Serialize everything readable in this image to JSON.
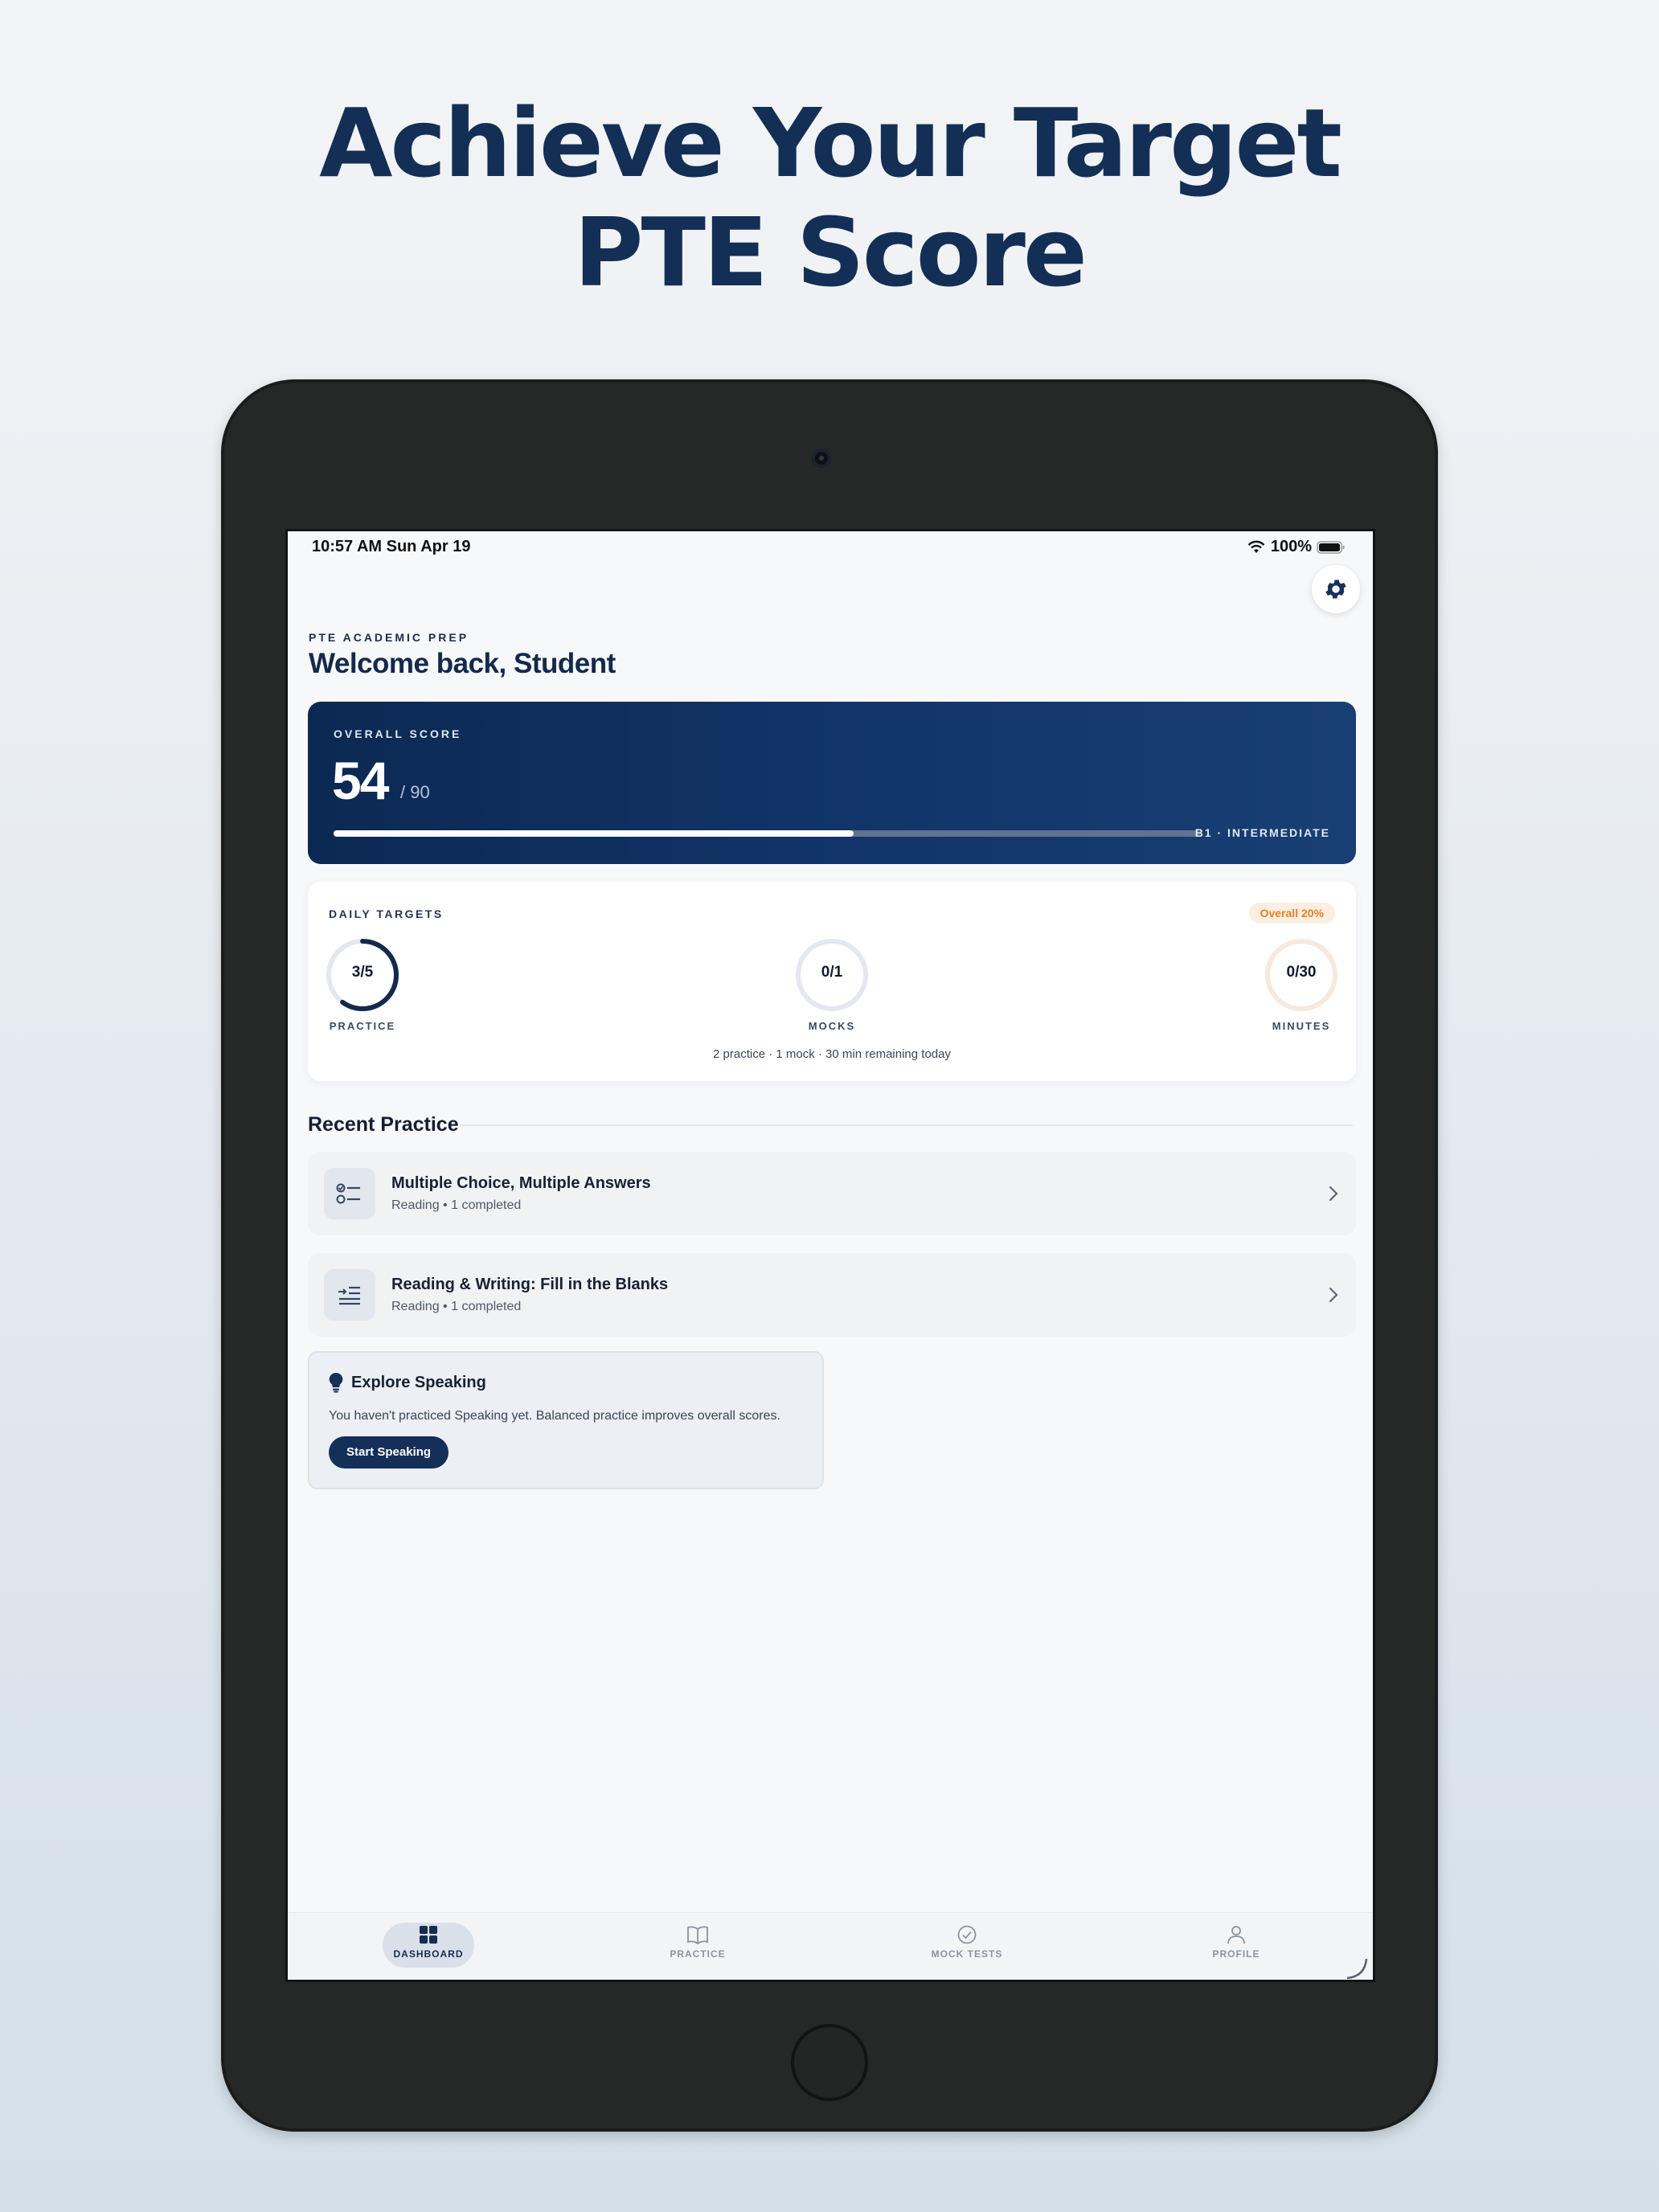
{
  "headline": {
    "line1": "Achieve Your Target",
    "line2": "PTE Score"
  },
  "status_bar": {
    "time": "10:57 AM   Sun Apr 19",
    "battery": "100%"
  },
  "header": {
    "eyebrow": "PTE ACADEMIC PREP",
    "welcome": "Welcome back, Student"
  },
  "score": {
    "label": "OVERALL SCORE",
    "value": "54",
    "max": "/ 90",
    "level": "B1 · INTERMEDIATE",
    "progress_fraction": 0.6
  },
  "daily_targets": {
    "title": "DAILY TARGETS",
    "badge": "Overall 20%",
    "rings": [
      {
        "value": "3/5",
        "label": "PRACTICE",
        "fraction": 0.6,
        "color": "#14294b",
        "track": "#e4e8ee"
      },
      {
        "value": "0/1",
        "label": "MOCKS",
        "fraction": 0,
        "color": "#14294b",
        "track": "#e4e8ee"
      },
      {
        "value": "0/30",
        "label": "MINUTES",
        "fraction": 0,
        "color": "#e2822a",
        "track": "#f6e9dd"
      }
    ],
    "summary": "2 practice · 1 mock · 30 min remaining today"
  },
  "recent_practice": {
    "title": "Recent Practice",
    "items": [
      {
        "title": "Multiple Choice, Multiple Answers",
        "subtitle": "Reading • 1 completed",
        "icon": "checklist-icon"
      },
      {
        "title": "Reading & Writing: Fill in the Blanks",
        "subtitle": "Reading • 1 completed",
        "icon": "fill-blanks-icon"
      }
    ]
  },
  "explore": {
    "title": "Explore Speaking",
    "text": "You haven't practiced Speaking yet. Balanced practice improves overall scores.",
    "button": "Start Speaking",
    "icon": "lightbulb-icon"
  },
  "tabs": [
    {
      "label": "DASHBOARD",
      "icon": "dashboard-icon",
      "active": true
    },
    {
      "label": "PRACTICE",
      "icon": "book-icon",
      "active": false
    },
    {
      "label": "MOCK TESTS",
      "icon": "check-circle-icon",
      "active": false
    },
    {
      "label": "PROFILE",
      "icon": "person-icon",
      "active": false
    }
  ],
  "colors": {
    "brand_navy": "#142f55",
    "accent_orange": "#e2822a"
  }
}
